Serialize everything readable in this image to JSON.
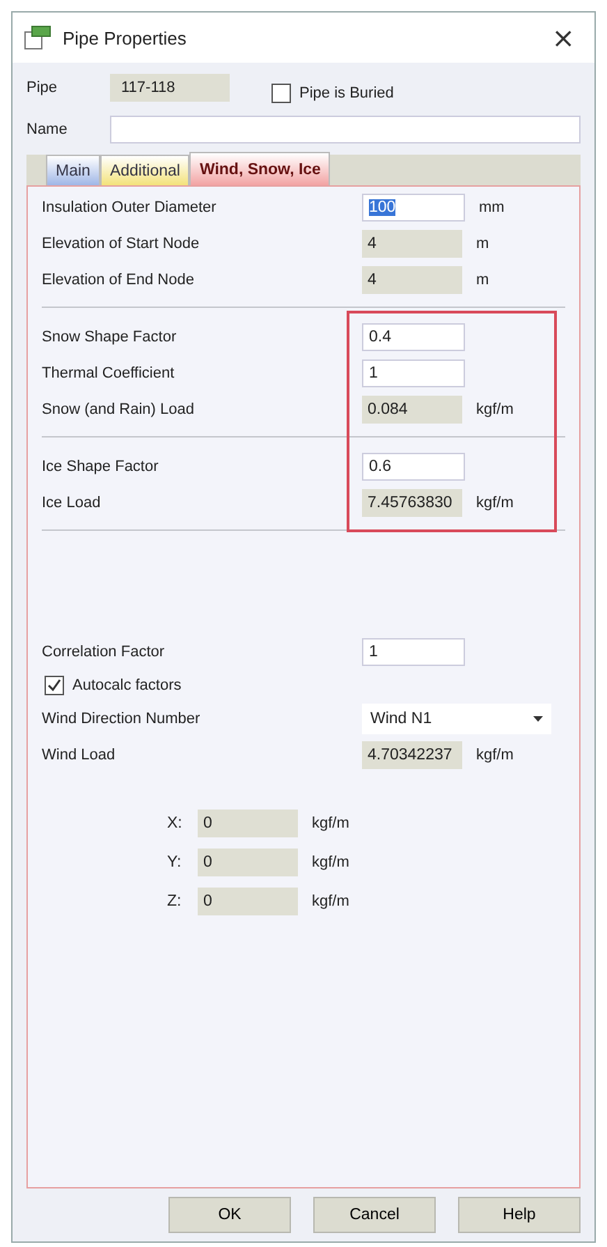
{
  "window": {
    "title": "Pipe Properties",
    "close": "×"
  },
  "pipe": {
    "label": "Pipe",
    "value": "117-118",
    "buried": {
      "label": "Pipe is Buried",
      "checked": false
    }
  },
  "name": {
    "label": "Name"
  },
  "tabs": [
    {
      "label": "Main",
      "selected": false,
      "color": "#9fb6e6"
    },
    {
      "label": "Additional",
      "selected": false,
      "color": "#f3e27a"
    },
    {
      "label": "Wind, Snow, Ice",
      "selected": true,
      "color": "#f2a3a3"
    }
  ],
  "sections": [
    {
      "highlighted": false,
      "rows": [
        {
          "label": "Insulation Outer Diameter",
          "value": "100",
          "unit": "mm",
          "editable": true,
          "text_selected": true
        },
        {
          "label": "Elevation of Start Node",
          "value": "4",
          "unit": "m",
          "editable": false,
          "text_selected": false
        },
        {
          "label": "Elevation of End Node",
          "value": "4",
          "unit": "m",
          "editable": false,
          "text_selected": false
        }
      ]
    },
    {
      "highlighted": true,
      "rows": [
        {
          "label": "Snow Shape Factor",
          "value": "0.4",
          "editable": true,
          "text_selected": false
        },
        {
          "label": "Thermal Coefficient",
          "value": "1",
          "editable": true,
          "text_selected": false
        },
        {
          "label": "Snow (and Rain) Load",
          "value": "0.084",
          "unit": "kgf/m",
          "editable": false,
          "text_selected": false
        }
      ]
    },
    {
      "highlighted": true,
      "rows": [
        {
          "label": "Ice Shape Factor",
          "value": "0.6",
          "editable": true,
          "text_selected": false
        },
        {
          "label": "Ice Load",
          "value": "7.45763830",
          "unit": "kgf/m",
          "editable": false,
          "text_selected": false
        }
      ]
    }
  ],
  "wind": {
    "correlation": {
      "label": "Correlation Factor",
      "value": "1"
    },
    "autocalc": {
      "label": "Autocalc factors",
      "checked": true
    },
    "direction": {
      "label": "Wind Direction Number",
      "value": "Wind N1"
    },
    "load": {
      "label": "Wind Load",
      "value": "4.70342237",
      "unit": "kgf/m"
    },
    "components": [
      {
        "label": "X:",
        "value": "0",
        "unit": "kgf/m"
      },
      {
        "label": "Y:",
        "value": "0",
        "unit": "kgf/m"
      },
      {
        "label": "Z:",
        "value": "0",
        "unit": "kgf/m"
      }
    ]
  },
  "buttons": [
    "OK",
    "Cancel",
    "Help"
  ]
}
